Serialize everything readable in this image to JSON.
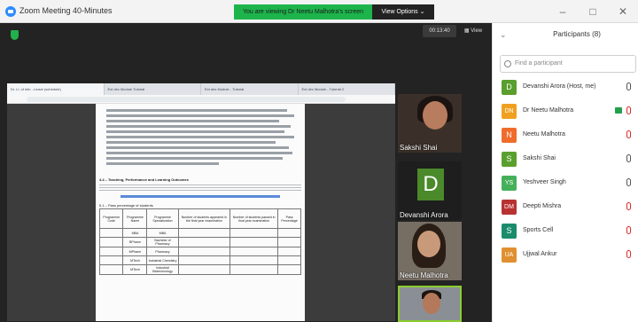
{
  "window": {
    "title": "Zoom Meeting 40-Minutes",
    "share_banner": "You are viewing Dr Neetu Malhotra's screen",
    "view_options": "View Options ⌄",
    "controls": [
      "–",
      "□",
      "✕"
    ]
  },
  "toolbar": {
    "timer": "00:13:40",
    "view_label": "View"
  },
  "browser": {
    "tabs": [
      "Dr. Ll. of info - Leave (schedule)",
      "Ext dec Module Tutorial",
      "Ext des Module - Tutorial",
      "Ext dec Module - Tutorial 2"
    ]
  },
  "document": {
    "section_title": "4.4 – Teaching, Performance and Learning Outcomes",
    "table_caption": "5.1 – Pass percentage of students",
    "columns": [
      "Programme Code",
      "Programme Name",
      "Programme Specialization",
      "Number of students appeared in the final year examination",
      "Number of students passed in final year examination",
      "Pass Percentage"
    ],
    "rows": [
      [
        "",
        "MBA",
        "MBA",
        "",
        "",
        ""
      ],
      [
        "",
        "BPharm",
        "Bachelor of Pharmacy",
        "",
        "",
        ""
      ],
      [
        "",
        "MPharm",
        "Pharmacy",
        "",
        "",
        ""
      ],
      [
        "",
        "MTech",
        "Industrial Chemistry",
        "",
        "",
        ""
      ],
      [
        "",
        "MTech",
        "Industrial Biotechnology",
        "",
        "",
        ""
      ]
    ]
  },
  "video_tiles": [
    {
      "name": "Sakshi Shai"
    },
    {
      "name": "Devanshi Arora",
      "initial": "D"
    },
    {
      "name": "Neetu Malhotra"
    }
  ],
  "panel": {
    "title": "Participants (8)",
    "search_placeholder": "Find a participant",
    "participants": [
      {
        "initials": "D",
        "name": "Devanshi Arora (Host, me)",
        "color": "#5a9e2e",
        "mic": "on",
        "video": false
      },
      {
        "initials": "DN",
        "name": "Dr Neetu Malhotra",
        "color": "#f0a020",
        "mic": "off",
        "video": true
      },
      {
        "initials": "N",
        "name": "Neetu Malhotra",
        "color": "#ef6c2c",
        "mic": "off",
        "video": false
      },
      {
        "initials": "S",
        "name": "Sakshi Shai",
        "color": "#5aa02e",
        "mic": "on",
        "video": false
      },
      {
        "initials": "YS",
        "name": "Yeshveer Singh",
        "color": "#45b05a",
        "mic": "on",
        "video": false
      },
      {
        "initials": "DM",
        "name": "Deepti Mishra",
        "color": "#b83232",
        "mic": "off",
        "video": false
      },
      {
        "initials": "S",
        "name": "Sports Cell",
        "color": "#1a8c6c",
        "mic": "off",
        "video": false
      },
      {
        "initials": "UA",
        "name": "Ujjwal Ankur",
        "color": "#e09030",
        "mic": "off",
        "video": false
      }
    ]
  }
}
